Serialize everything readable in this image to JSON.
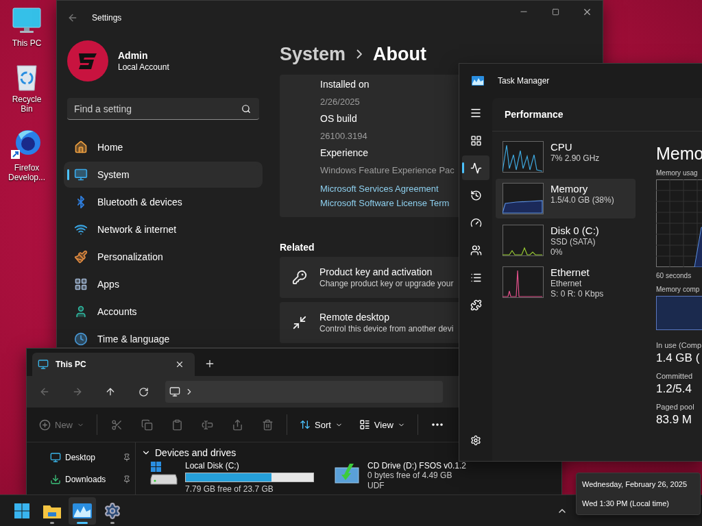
{
  "desktop_icons": [
    {
      "label": "This PC"
    },
    {
      "label": "Recycle Bin"
    },
    {
      "label": "Firefox Develop..."
    }
  ],
  "settings": {
    "title": "Settings",
    "user": {
      "name": "Admin",
      "account": "Local Account"
    },
    "search": {
      "placeholder": "Find a setting"
    },
    "nav": [
      {
        "label": "Home",
        "selected": false
      },
      {
        "label": "System",
        "selected": true
      },
      {
        "label": "Bluetooth & devices",
        "selected": false
      },
      {
        "label": "Network & internet",
        "selected": false
      },
      {
        "label": "Personalization",
        "selected": false
      },
      {
        "label": "Apps",
        "selected": false
      },
      {
        "label": "Accounts",
        "selected": false
      },
      {
        "label": "Time & language",
        "selected": false
      }
    ],
    "breadcrumb": [
      "System",
      "About"
    ],
    "specs": [
      {
        "label": "Installed on",
        "value": "2/26/2025"
      },
      {
        "label": "OS build",
        "value": "26100.3194"
      },
      {
        "label": "Experience",
        "value": "Windows Feature Experience Pac"
      }
    ],
    "links": [
      "Microsoft Services Agreement",
      "Microsoft Software License Term"
    ],
    "related": {
      "heading": "Related",
      "items": [
        {
          "title": "Product key and activation",
          "subtitle": "Change product key or upgrade your"
        },
        {
          "title": "Remote desktop",
          "subtitle": "Control this device from another devi"
        }
      ]
    }
  },
  "task_manager": {
    "title": "Task Manager",
    "rail": [
      {
        "selected": false
      },
      {
        "selected": true
      },
      {
        "selected": false
      },
      {
        "selected": false
      },
      {
        "selected": false
      },
      {
        "selected": false
      },
      {
        "selected": false
      }
    ],
    "page_title": "Performance",
    "resources": [
      {
        "name": "CPU",
        "details": [
          "7% 2.90 GHz"
        ],
        "selected": false
      },
      {
        "name": "Memory",
        "details": [
          "1.5/4.0 GB (38%)"
        ],
        "selected": true
      },
      {
        "name": "Disk 0 (C:)",
        "details": [
          "SSD (SATA)",
          "0%"
        ],
        "selected": false
      },
      {
        "name": "Ethernet",
        "details": [
          "Ethernet",
          "S: 0 R: 0 Kbps"
        ],
        "selected": false
      }
    ],
    "detail": {
      "heading": "Memo",
      "usage_label": "Memory usag",
      "time_label": "60 seconds",
      "composition_label": "Memory comp",
      "stats": [
        {
          "label": "In use (Comp",
          "value": "1.4 GB ("
        },
        {
          "label": "Committed",
          "value": "1.2/5.4"
        },
        {
          "label": "Paged pool",
          "value": "83.9 M"
        }
      ]
    }
  },
  "explorer": {
    "tab": "This PC",
    "toolbar": {
      "new": {
        "label": "New",
        "disabled": true
      },
      "sort": "Sort",
      "view": "View"
    },
    "quick_access": [
      {
        "label": "Desktop",
        "pinned": true
      },
      {
        "label": "Downloads",
        "pinned": true
      }
    ],
    "section": {
      "title": "Devices and drives",
      "expanded": true
    },
    "drives": [
      {
        "kind": "disk",
        "name": "Local Disk (C:)",
        "level": 0.67,
        "info": [
          "7.79 GB free of 23.7 GB"
        ]
      },
      {
        "kind": "cd",
        "name": "CD Drive (D:) FSOS v0.1.2",
        "info": [
          "0 bytes free of 4.49 GB",
          "UDF"
        ]
      }
    ]
  },
  "taskbar": {
    "apps": [
      {
        "running": false,
        "selected": false
      },
      {
        "running": true,
        "selected": false
      },
      {
        "running": true,
        "selected": true
      },
      {
        "running": true,
        "selected": false
      }
    ]
  },
  "clock_tooltip": [
    "Wednesday, February 26, 2025",
    "Wed 1:30 PM (Local time)"
  ]
}
